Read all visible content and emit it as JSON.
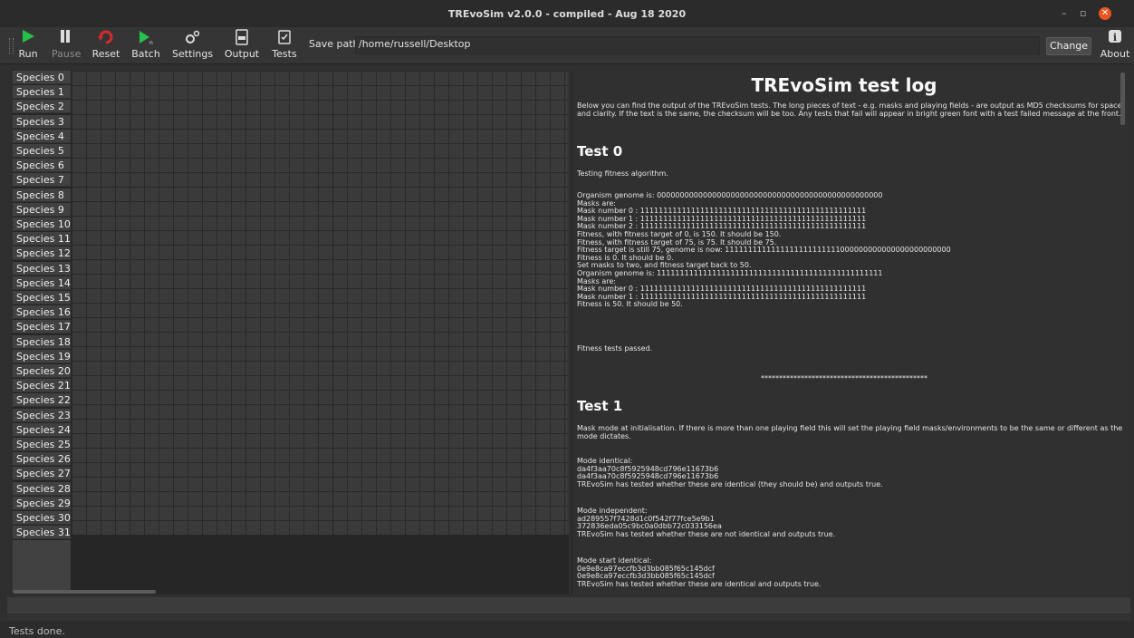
{
  "window": {
    "title": "TREvoSim v2.0.0 - compiled - Aug 18 2020",
    "minimize": "–",
    "restore": "▫",
    "close": "✕"
  },
  "toolbar": {
    "run": "Run",
    "pause": "Pause",
    "reset": "Reset",
    "batch": "Batch",
    "settings": "Settings",
    "output": "Output",
    "tests": "Tests",
    "save_path_label": "Save path:",
    "save_path_value": "/home/russell/Desktop",
    "change": "Change",
    "about": "About"
  },
  "icons": {
    "run": "play-icon",
    "pause": "pause-icon",
    "reset": "reset-icon",
    "batch": "batch-play-icon",
    "settings": "gears-icon",
    "output": "log-file-icon",
    "tests": "checklist-icon",
    "about": "info-icon"
  },
  "colors": {
    "run": "#27c04a",
    "reset": "#d42b2b",
    "close": "#e95420"
  },
  "species": [
    "Species 0",
    "Species 1",
    "Species 2",
    "Species 3",
    "Species 4",
    "Species 5",
    "Species 6",
    "Species 7",
    "Species 8",
    "Species 9",
    "Species 10",
    "Species 11",
    "Species 12",
    "Species 13",
    "Species 14",
    "Species 15",
    "Species 16",
    "Species 17",
    "Species 18",
    "Species 19",
    "Species 20",
    "Species 21",
    "Species 22",
    "Species 23",
    "Species 24",
    "Species 25",
    "Species 26",
    "Species 27",
    "Species 28",
    "Species 29",
    "Species 30",
    "Species 31"
  ],
  "log": {
    "title": "TREvoSim test log",
    "intro": "Below you can find the output of the TREvoSim tests. The long pieces of text - e.g. masks and playing fields - are output as MD5 checksums for space and clarity. If the text is the same, the checksum will be too. Any tests that fail will appear in bright green font with a test failed message at the front.",
    "test0_heading": "Test 0",
    "test0_desc": "Testing fitness algorithm.",
    "test0_body": "Organism genome is: 0000000000000000000000000000000000000000000000000\nMasks are:\nMask number 0 : 1111111111111111111111111111111111111111111111111\nMask number 1 : 1111111111111111111111111111111111111111111111111\nMask number 2 : 1111111111111111111111111111111111111111111111111\nFitness, with fitness target of 0, is 150. It should be 150.\nFitness, with fitness target of 75, is 75. It should be 75.\nFitness target is still 75, genome is now: 1111111111111111111111111000000000000000000000000\nFitness is 0. It should be 0.\nSet masks to two, and fitness target back to 50.\nOrganism genome is: 1111111111111111111111111111111111111111111111111\nMasks are:\nMask number 0 : 1111111111111111111111111111111111111111111111111\nMask number 1 : 1111111111111111111111111111111111111111111111111\nFitness is 50. It should be 50.",
    "test0_result": "Fitness tests passed.",
    "separator": "**********************************************",
    "test1_heading": "Test 1",
    "test1_desc": "Mask mode at initialisation. If there is more than one playing field this will set the playing field masks/environments to be the same or different as the mode dictates.",
    "test1_identical": "Mode identical:\nda4f3aa70c8f5925948cd796e11673b6\nda4f3aa70c8f5925948cd796e11673b6\nTREvoSim has tested whether these are identical (they should be) and outputs true.",
    "test1_independent": "Mode independent:\nad289557f7428d1c0f542f77fce5e9b1\n372836eda05c9bc0a0dbb72c033156ea\nTREvoSim has tested whether these are not identical and outputs true.",
    "test1_start_identical": "Mode start identical:\n0e9e8ca97eccfb3d3bb085f65c145dcf\n0e9e8ca97eccfb3d3bb085f65c145dcf\nTREvoSim has tested whether these are identical and outputs true."
  },
  "status": "Tests done."
}
